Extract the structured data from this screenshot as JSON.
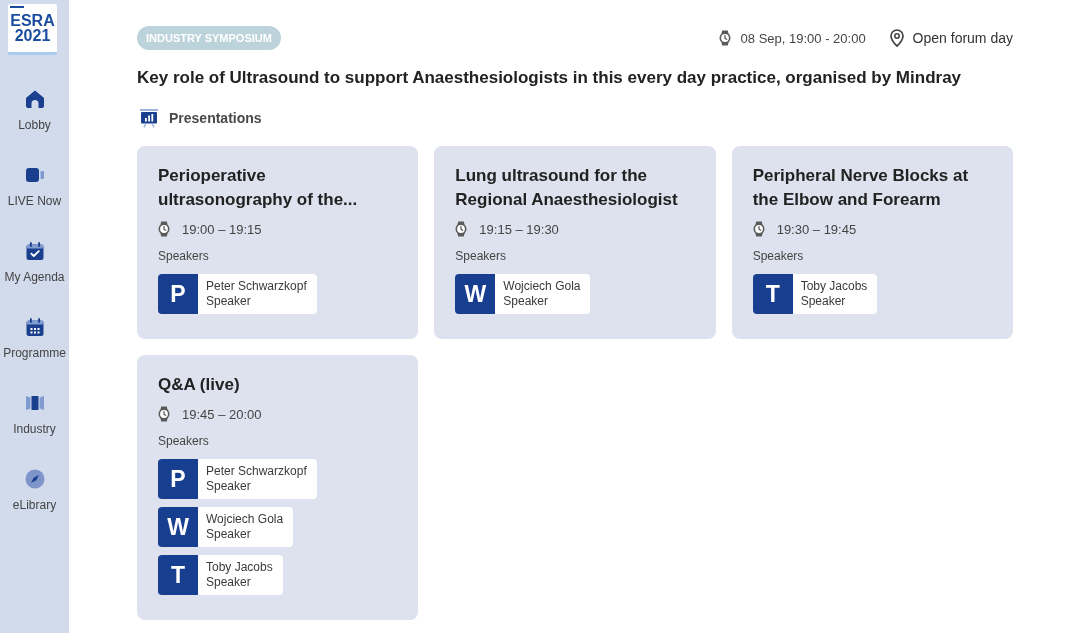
{
  "sidebar": {
    "logo": "ESRA 2021",
    "items": [
      {
        "label": "Lobby"
      },
      {
        "label": "LIVE Now"
      },
      {
        "label": "My Agenda"
      },
      {
        "label": "Programme"
      },
      {
        "label": "Industry"
      },
      {
        "label": "eLibrary"
      }
    ]
  },
  "session": {
    "category": "INDUSTRY SYMPOSIUM",
    "time": "08 Sep, 19:00 - 20:00",
    "location": "Open forum day",
    "title": "Key role of Ultrasound to support Anaesthesiologists in this every day practice, organised by Mindray",
    "section_label": "Presentations",
    "presentations": [
      {
        "title": "Perioperative ultrasonography of the...",
        "time": "19:00 – 19:15",
        "speakers_label": "Speakers",
        "speakers": [
          {
            "initial": "P",
            "name": "Peter Schwarzkopf",
            "role": "Speaker"
          }
        ]
      },
      {
        "title": "Lung ultrasound for the Regional Anaesthesiologist",
        "time": "19:15 – 19:30",
        "speakers_label": "Speakers",
        "speakers": [
          {
            "initial": "W",
            "name": "Wojciech Gola",
            "role": "Speaker"
          }
        ]
      },
      {
        "title": "Peripheral Nerve Blocks at the Elbow and Forearm",
        "time": "19:30 – 19:45",
        "speakers_label": "Speakers",
        "speakers": [
          {
            "initial": "T",
            "name": "Toby Jacobs",
            "role": "Speaker"
          }
        ]
      },
      {
        "title": "Q&A (live)",
        "time": "19:45 – 20:00",
        "speakers_label": "Speakers",
        "speakers": [
          {
            "initial": "P",
            "name": "Peter Schwarzkopf",
            "role": "Speaker"
          },
          {
            "initial": "W",
            "name": "Wojciech Gola",
            "role": "Speaker"
          },
          {
            "initial": "T",
            "name": "Toby Jacobs",
            "role": "Speaker"
          }
        ]
      }
    ]
  }
}
